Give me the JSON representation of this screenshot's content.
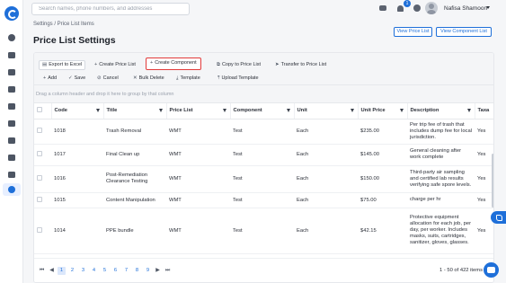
{
  "search": {
    "placeholder": "Search names, phone numbers, and addresses",
    "value": ""
  },
  "topbar": {
    "notification_count": "1",
    "user_name": "Nafisa Shamoon"
  },
  "breadcrumb": "Settings / Price List Items",
  "page_title": "Price List Settings",
  "header_buttons": {
    "view_price_list": "View Price List",
    "view_component_list": "View Component List"
  },
  "toolbar": {
    "export_excel": "Export to Excel",
    "create_price_list": "Create Price List",
    "create_component": "Create Component",
    "copy_to_price_list": "Copy to Price List",
    "transfer_to_price_list": "Transfer to Price List",
    "add": "Add",
    "save": "Save",
    "cancel": "Cancel",
    "bulk_delete": "Bulk Delete",
    "template": "Template",
    "upload_template": "Upload Template"
  },
  "group_hint": "Drag a column header and drop it here to group by that column",
  "table": {
    "columns": [
      "Code",
      "Title",
      "Price List",
      "Component",
      "Unit",
      "Unit Price",
      "Description",
      "Taxa"
    ],
    "rows": [
      {
        "code": "1018",
        "title": "Trash Removal",
        "price_list": "WMT",
        "component": "Test",
        "unit": "Each",
        "unit_price": "$235.00",
        "description": "Per trip fee of trash that includes dump fee for local jurisdiction.",
        "taxable": "Yes"
      },
      {
        "code": "1017",
        "title": "Final Clean up",
        "price_list": "WMT",
        "component": "Test",
        "unit": "Each",
        "unit_price": "$145.00",
        "description": "General cleaning after work complete",
        "taxable": "Yes"
      },
      {
        "code": "1016",
        "title": "Post-Remediation Clearance Testing",
        "price_list": "WMT",
        "component": "Test",
        "unit": "Each",
        "unit_price": "$150.00",
        "description": "Third-party air sampling and certified lab results verifying safe spore levels.",
        "taxable": "Yes"
      },
      {
        "code": "1015",
        "title": "Content Manipulation",
        "price_list": "WMT",
        "component": "Test",
        "unit": "Each",
        "unit_price": "$75.00",
        "description": "charge per hr",
        "taxable": "Yes"
      },
      {
        "code": "1014",
        "title": "PPE bundle",
        "price_list": "WMT",
        "component": "Test",
        "unit": "Each",
        "unit_price": "$42.15",
        "description": "Protective equipment allocation for each job, per day, per worker. Includes masks, suits, cartridges, sanitizer, gloves, glasses.",
        "taxable": "Yes"
      }
    ]
  },
  "pagination": {
    "pages": [
      "1",
      "2",
      "3",
      "4",
      "5",
      "6",
      "7",
      "8",
      "9"
    ],
    "current": "1",
    "first": "⏮",
    "prev": "◀",
    "next": "▶",
    "last": "⏭",
    "info": "1 - 50 of 422 items"
  },
  "icons": {
    "sidebar": [
      "dashboard-icon",
      "briefcase-icon",
      "calendar-icon",
      "map-icon",
      "handshake-icon",
      "phone-icon",
      "folder-icon",
      "truck-icon",
      "team-icon",
      "settings-icon"
    ]
  },
  "colors": {
    "accent": "#1e6fd9",
    "highlight": "#e23b3b"
  }
}
